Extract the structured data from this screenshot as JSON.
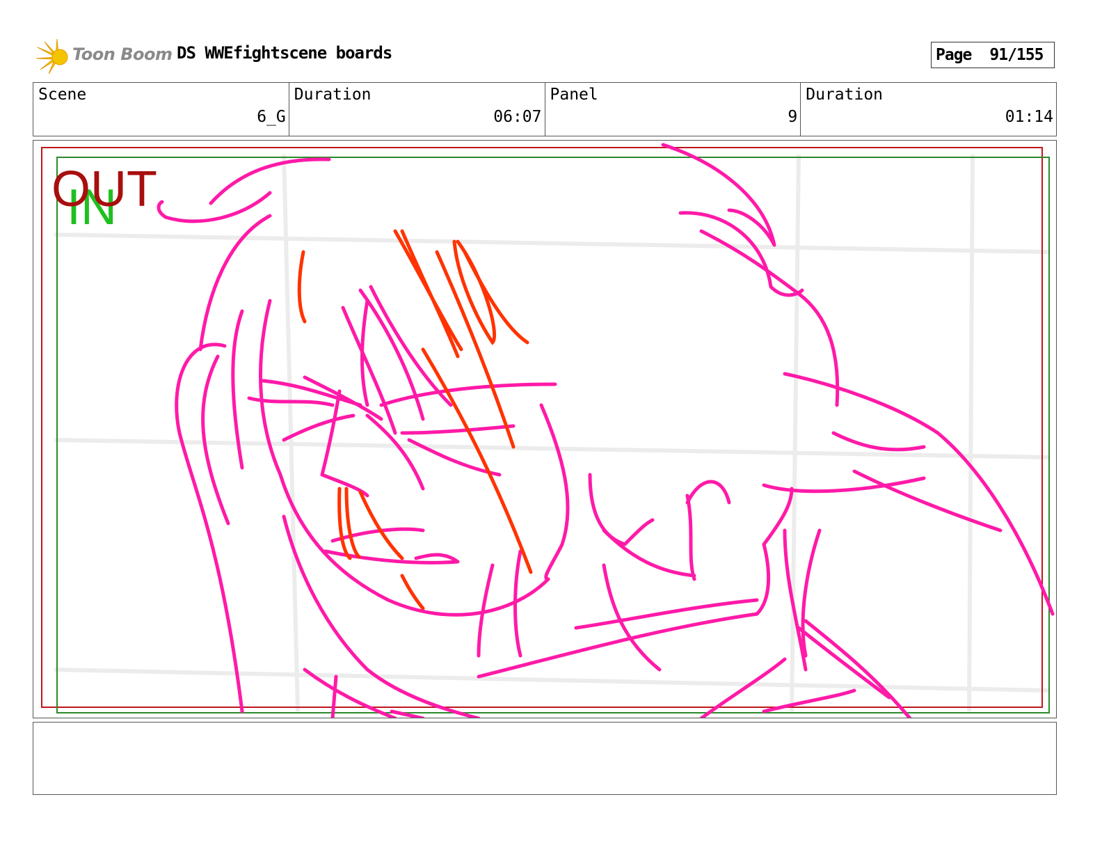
{
  "header": {
    "logo_text": "Toon Boom",
    "title": "DS WWEfightscene boards",
    "page_label": "Page",
    "page_value": "91/155"
  },
  "info": [
    {
      "label": "Scene",
      "value": "6_G"
    },
    {
      "label": "Duration",
      "value": "06:07"
    },
    {
      "label": "Panel",
      "value": "9"
    },
    {
      "label": "Duration",
      "value": "01:14"
    }
  ],
  "panel": {
    "in_label": "IN",
    "out_label": "OUT"
  },
  "colors": {
    "sketch_main": "#ff1aa8",
    "sketch_accent": "#ff3300",
    "frame_out": "#c0141c",
    "frame_in": "#2a8a2a",
    "logo_star": "#f5c400"
  },
  "notes": ""
}
